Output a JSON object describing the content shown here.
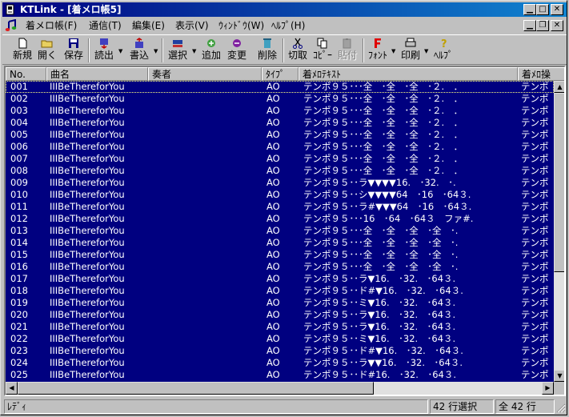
{
  "window": {
    "title": "KTLink - [着メロ帳5]",
    "icon": "ktlink-app-icon"
  },
  "menu": {
    "items": [
      "着メロ帳(F)",
      "通信(T)",
      "編集(E)",
      "表示(V)",
      "ｳｨﾝﾄﾞｳ(W)",
      "ﾍﾙﾌﾟ(H)"
    ]
  },
  "toolbar": {
    "buttons": [
      {
        "label": "新規",
        "icon": "new-file-icon"
      },
      {
        "label": "開く",
        "icon": "open-folder-icon"
      },
      {
        "label": "保存",
        "icon": "save-disk-icon"
      },
      {
        "label": "読出",
        "icon": "read-device-icon"
      },
      {
        "label": "書込",
        "icon": "write-device-icon"
      },
      {
        "label": "選択",
        "icon": "select-icon"
      },
      {
        "label": "追加",
        "icon": "add-icon"
      },
      {
        "label": "変更",
        "icon": "change-icon"
      },
      {
        "label": "削除",
        "icon": "delete-icon"
      },
      {
        "label": "切取",
        "icon": "cut-icon"
      },
      {
        "label": "ｺﾋﾟｰ",
        "icon": "copy-icon"
      },
      {
        "label": "貼付",
        "icon": "paste-icon",
        "disabled": true
      },
      {
        "label": "ﾌｫﾝﾄ",
        "icon": "font-icon"
      },
      {
        "label": "印刷",
        "icon": "print-icon"
      },
      {
        "label": "ﾍﾙﾌﾟ",
        "icon": "help-icon"
      }
    ]
  },
  "list": {
    "columns": [
      "No.",
      "曲名",
      "奏者",
      "ﾀｲﾌﾟ",
      "着ﾒﾛﾃｷｽﾄ",
      "着ﾒﾛ操"
    ],
    "selection_color": "#000080",
    "rows": [
      {
        "no": "001",
        "title": "IIIBeThereforYou",
        "artist": "",
        "type": "AO",
        "text": "テンポ９５･･･全　･全　･全　･２.　．",
        "ops": "テンポ"
      },
      {
        "no": "002",
        "title": "IIIBeThereforYou",
        "artist": "",
        "type": "AO",
        "text": "テンポ９５･･･全　･全　･全　･２.　．",
        "ops": "テンポ"
      },
      {
        "no": "003",
        "title": "IIIBeThereforYou",
        "artist": "",
        "type": "AO",
        "text": "テンポ９５･･･全　･全　･全　･２.　．",
        "ops": "テンポ"
      },
      {
        "no": "004",
        "title": "IIIBeThereforYou",
        "artist": "",
        "type": "AO",
        "text": "テンポ９５･･･全　･全　･全　･２.　．",
        "ops": "テンポ"
      },
      {
        "no": "005",
        "title": "IIIBeThereforYou",
        "artist": "",
        "type": "AO",
        "text": "テンポ９５･･･全　･全　･全　･２.　．",
        "ops": "テンポ"
      },
      {
        "no": "006",
        "title": "IIIBeThereforYou",
        "artist": "",
        "type": "AO",
        "text": "テンポ９５･･･全　･全　･全　･２.　．",
        "ops": "テンポ"
      },
      {
        "no": "007",
        "title": "IIIBeThereforYou",
        "artist": "",
        "type": "AO",
        "text": "テンポ９５･･･全　･全　･全　･２.　．",
        "ops": "テンポ"
      },
      {
        "no": "008",
        "title": "IIIBeThereforYou",
        "artist": "",
        "type": "AO",
        "text": "テンポ９５･･･全　･全　･全　･２.　．",
        "ops": "テンポ"
      },
      {
        "no": "009",
        "title": "IIIBeThereforYou",
        "artist": "",
        "type": "AO",
        "text": "テンポ９５･･ラ▼▼▼▼16.　･32.　･.",
        "ops": "テンポ"
      },
      {
        "no": "010",
        "title": "IIIBeThereforYou",
        "artist": "",
        "type": "AO",
        "text": "テンポ９５･･シ▼▼▼▼64　･16　･64３.",
        "ops": "テンポ"
      },
      {
        "no": "011",
        "title": "IIIBeThereforYou",
        "artist": "",
        "type": "AO",
        "text": "テンポ９５･･ラ#▼▼▼64　･16　･64３.",
        "ops": "テンポ"
      },
      {
        "no": "012",
        "title": "IIIBeThereforYou",
        "artist": "",
        "type": "AO",
        "text": "テンポ９５･･･16　･64　･64３　ファ#.",
        "ops": "テンポ"
      },
      {
        "no": "013",
        "title": "IIIBeThereforYou",
        "artist": "",
        "type": "AO",
        "text": "テンポ９５･･･全　･全　･全　･全　･.",
        "ops": "テンポ"
      },
      {
        "no": "014",
        "title": "IIIBeThereforYou",
        "artist": "",
        "type": "AO",
        "text": "テンポ９５･･･全　･全　･全　･全　･.",
        "ops": "テンポ"
      },
      {
        "no": "015",
        "title": "IIIBeThereforYou",
        "artist": "",
        "type": "AO",
        "text": "テンポ９５･･･全　･全　･全　･全　･.",
        "ops": "テンポ"
      },
      {
        "no": "016",
        "title": "IIIBeThereforYou",
        "artist": "",
        "type": "AO",
        "text": "テンポ９５･･･全　･全　･全　･全　･.",
        "ops": "テンポ"
      },
      {
        "no": "017",
        "title": "IIIBeThereforYou",
        "artist": "",
        "type": "AO",
        "text": "テンポ９５･･ラ▼16.　･32.　･64３.",
        "ops": "テンポ"
      },
      {
        "no": "018",
        "title": "IIIBeThereforYou",
        "artist": "",
        "type": "AO",
        "text": "テンポ９５･･ド#▼16.　･32.　･64３.",
        "ops": "テンポ"
      },
      {
        "no": "019",
        "title": "IIIBeThereforYou",
        "artist": "",
        "type": "AO",
        "text": "テンポ９５･･ミ▼16.　･32.　･64３.",
        "ops": "テンポ"
      },
      {
        "no": "020",
        "title": "IIIBeThereforYou",
        "artist": "",
        "type": "AO",
        "text": "テンポ９５･･ラ▼16.　･32.　･64３.",
        "ops": "テンポ"
      },
      {
        "no": "021",
        "title": "IIIBeThereforYou",
        "artist": "",
        "type": "AO",
        "text": "テンポ９５･･ラ▼16.　･32.　･64３.",
        "ops": "テンポ"
      },
      {
        "no": "022",
        "title": "IIIBeThereforYou",
        "artist": "",
        "type": "AO",
        "text": "テンポ９５･･ミ▼16.　･32.　･64３.",
        "ops": "テンポ"
      },
      {
        "no": "023",
        "title": "IIIBeThereforYou",
        "artist": "",
        "type": "AO",
        "text": "テンポ９５･･ド#▼16.　･32.　･64３.",
        "ops": "テンポ"
      },
      {
        "no": "024",
        "title": "IIIBeThereforYou",
        "artist": "",
        "type": "AO",
        "text": "テンポ９５･･ラ▼▼16.　･32.　･64３.",
        "ops": "テンポ"
      },
      {
        "no": "025",
        "title": "IIIBeThereforYou",
        "artist": "",
        "type": "AO",
        "text": "テンポ９５･･ド#16.　･32.　･64３.",
        "ops": "テンポ"
      }
    ]
  },
  "status": {
    "ready": "ﾚﾃﾞｨ",
    "selected": "42 行選択",
    "total": "全 42 行"
  }
}
